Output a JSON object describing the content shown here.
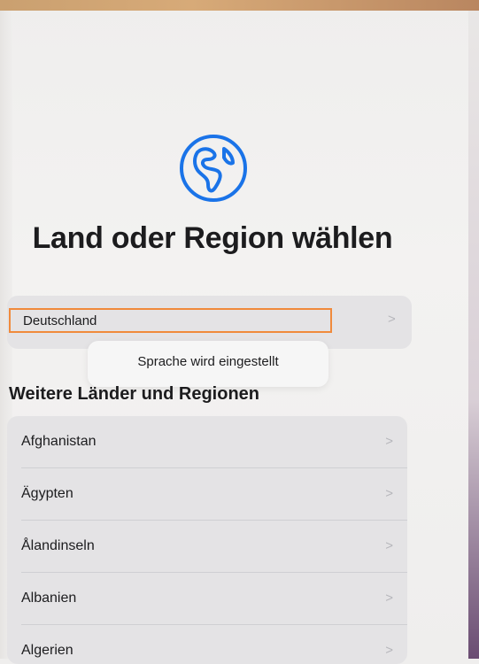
{
  "title": "Land oder Region wählen",
  "selected": {
    "label": "Deutschland"
  },
  "toast": {
    "text": "Sprache wird eingestellt"
  },
  "section_title": "Weitere Länder und Regionen",
  "countries": [
    {
      "label": "Afghanistan"
    },
    {
      "label": "Ägypten"
    },
    {
      "label": "Ålandinseln"
    },
    {
      "label": "Albanien"
    },
    {
      "label": "Algerien"
    }
  ],
  "chevron": ">",
  "icons": {
    "globe": "globe-icon"
  },
  "colors": {
    "accent": "#1a73e8",
    "highlight": "#f08a3c"
  }
}
